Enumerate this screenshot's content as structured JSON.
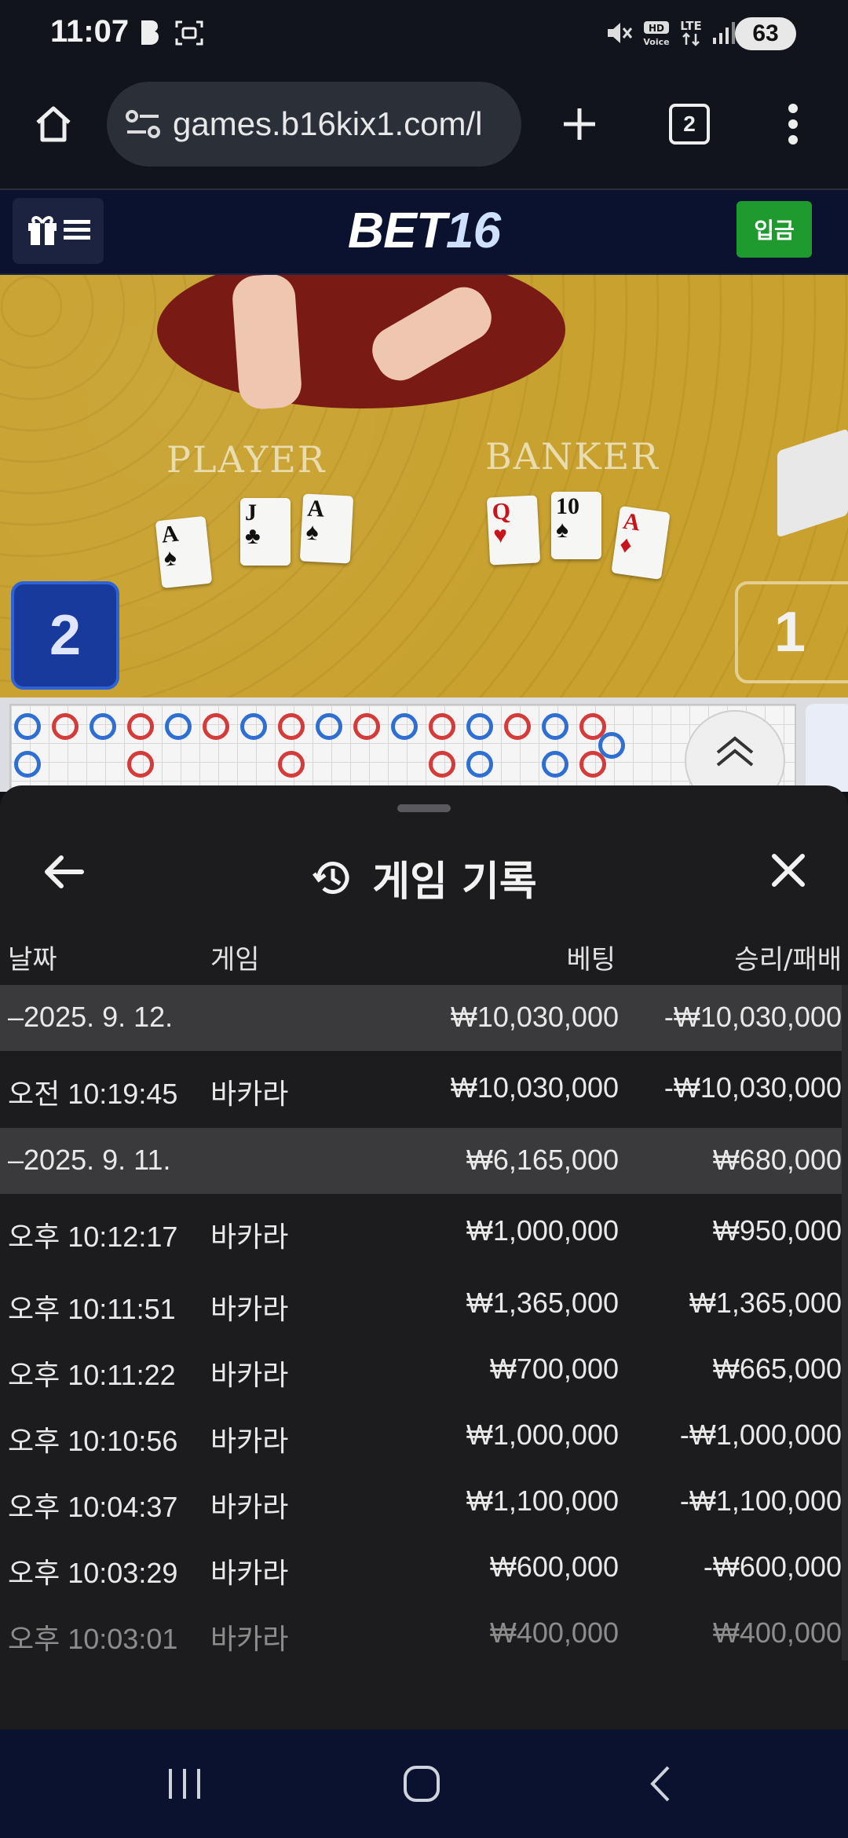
{
  "status_bar": {
    "time": "11:07",
    "battery": "63"
  },
  "browser": {
    "url": "games.b16kix1.com/l",
    "tab_count": "2"
  },
  "site": {
    "logo_main": "BET",
    "logo_accent": "16",
    "deposit_label": "입금"
  },
  "video": {
    "player_label": "PLAYER",
    "banker_label": "BANKER",
    "player_score": "2",
    "banker_score": "1",
    "player_cards": [
      {
        "rank": "A",
        "suit": "♠",
        "color": "black"
      },
      {
        "rank": "J",
        "suit": "♣",
        "color": "black"
      },
      {
        "rank": "A",
        "suit": "♠",
        "color": "black"
      }
    ],
    "banker_cards": [
      {
        "rank": "Q",
        "suit": "♥",
        "color": "red"
      },
      {
        "rank": "10",
        "suit": "♠",
        "color": "black"
      },
      {
        "rank": "A",
        "suit": "♦",
        "color": "red"
      }
    ]
  },
  "sheet": {
    "title": "게임 기록",
    "columns": {
      "date": "날짜",
      "game": "게임",
      "bet": "베팅",
      "winloss": "승리/패배"
    },
    "rows": [
      {
        "type": "date",
        "date": "–2025. 9. 12.",
        "game": "",
        "bet": "₩10,030,000",
        "winloss": "-₩10,030,000"
      },
      {
        "type": "entry",
        "date": "오전 10:19:45",
        "game": "바카라",
        "bet": "₩10,030,000",
        "winloss": "-₩10,030,000"
      },
      {
        "type": "date",
        "date": "–2025. 9. 11.",
        "game": "",
        "bet": "₩6,165,000",
        "winloss": "₩680,000"
      },
      {
        "type": "entry",
        "date": "오후 10:12:17",
        "game": "바카라",
        "bet": "₩1,000,000",
        "winloss": "₩950,000"
      },
      {
        "type": "entry",
        "date": "오후 10:11:51",
        "game": "바카라",
        "bet": "₩1,365,000",
        "winloss": "₩1,365,000"
      },
      {
        "type": "entry",
        "date": "오후 10:11:22",
        "game": "바카라",
        "bet": "₩700,000",
        "winloss": "₩665,000"
      },
      {
        "type": "entry",
        "date": "오후 10:10:56",
        "game": "바카라",
        "bet": "₩1,000,000",
        "winloss": "-₩1,000,000"
      },
      {
        "type": "entry",
        "date": "오후 10:04:37",
        "game": "바카라",
        "bet": "₩1,100,000",
        "winloss": "-₩1,100,000"
      },
      {
        "type": "entry",
        "date": "오후 10:03:29",
        "game": "바카라",
        "bet": "₩600,000",
        "winloss": "-₩600,000"
      },
      {
        "type": "entry",
        "date": "오후 10:03:01",
        "game": "바카라",
        "bet": "₩400,000",
        "winloss": "₩400,000"
      }
    ]
  },
  "colors": {
    "player_blue": "#2f6fd1",
    "banker_red": "#d43b3b",
    "deposit_green": "#1f9a2e",
    "sheet_bg": "#1c1c1e"
  }
}
